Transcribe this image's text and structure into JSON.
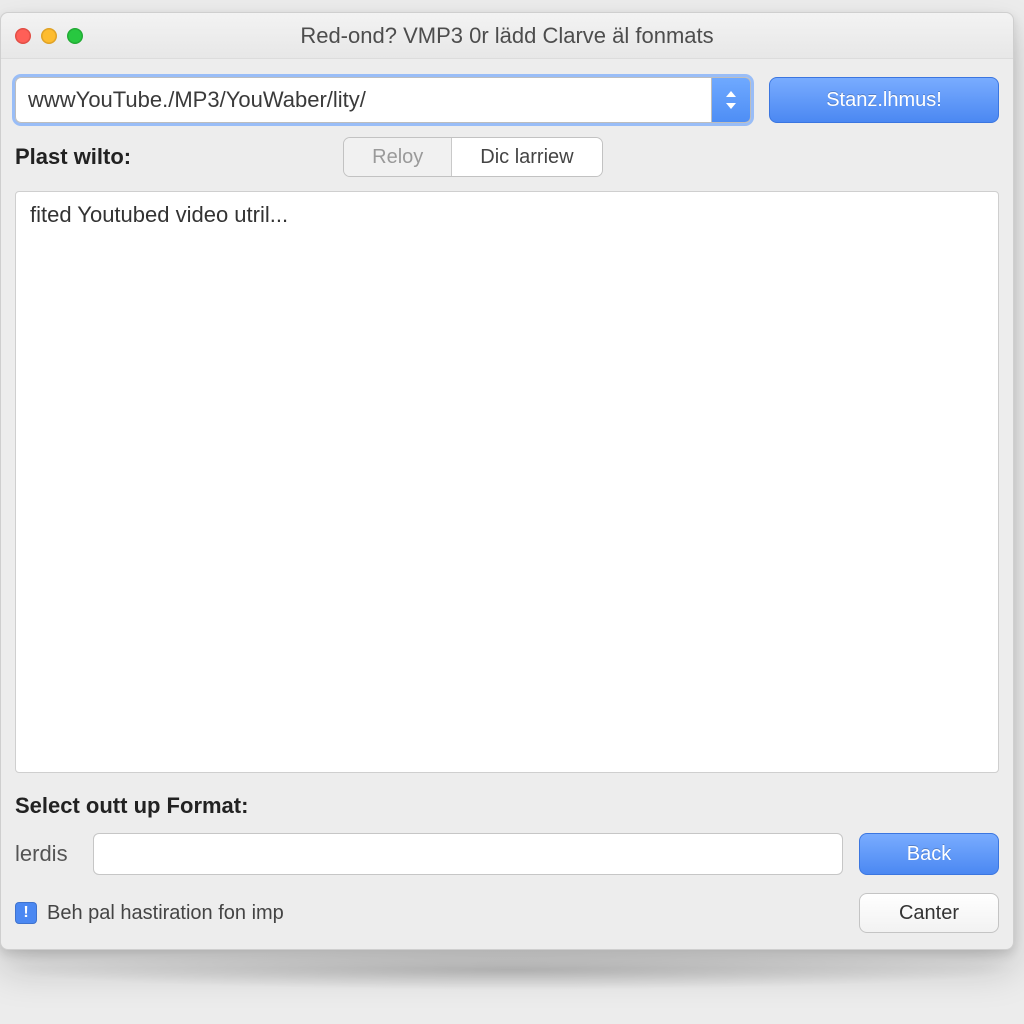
{
  "window": {
    "title": "Red-ond? VMP3 0r lädd Clarve äl fonmats"
  },
  "urlbar": {
    "value": "wwwYouTube./MP3/YouWaber/lity/",
    "action_label": "Stanz.lhmus!"
  },
  "playlist": {
    "label": "Plast wilto:",
    "segmented": {
      "left": "Reloy",
      "right": "Dic larriew"
    }
  },
  "list": {
    "items": [
      "fited Youtubed video utril..."
    ]
  },
  "format": {
    "section_label": "Select outt up Format:",
    "prefix": "lerdis",
    "value": "",
    "back_label": "Back"
  },
  "footer": {
    "info_glyph": "!",
    "info_text": "Beh pal hastiration fon imp",
    "canter_label": "Canter"
  }
}
